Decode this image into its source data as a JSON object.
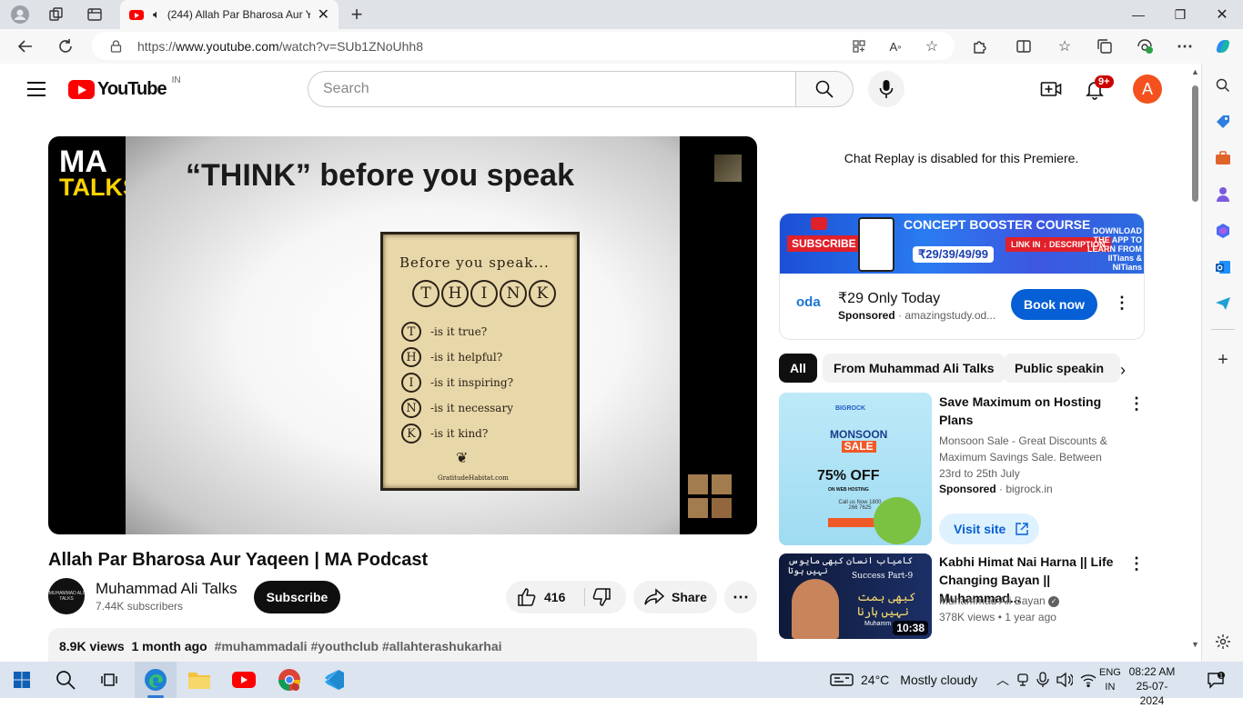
{
  "browser": {
    "tab_title": "(244) Allah Par Bharosa Aur Yaqe",
    "url_prefix": "https://",
    "url_domain": "www.youtube.com",
    "url_path": "/watch?v=SUb1ZNoUhh8"
  },
  "youtube": {
    "logo_text": "YouTube",
    "country_code": "IN",
    "search_placeholder": "Search",
    "notif_badge": "9+",
    "avatar_letter": "A"
  },
  "video": {
    "slide_heading": "“THINK” before you speak",
    "logo_line1": "MA",
    "logo_line2": "TALKS",
    "paper_title": "Before you speak...",
    "think_letters": [
      "T",
      "H",
      "I",
      "N",
      "K"
    ],
    "think_rows": [
      {
        "letter": "T",
        "text": "-is it true?"
      },
      {
        "letter": "H",
        "text": "-is it helpful?"
      },
      {
        "letter": "I",
        "text": "-is it inspiring?"
      },
      {
        "letter": "N",
        "text": "-is it necessary"
      },
      {
        "letter": "K",
        "text": "-is it kind?"
      }
    ],
    "paper_footer": "GratitudeHabitat.com",
    "title": "Allah Par Bharosa Aur Yaqeen | MA Podcast",
    "channel_name": "Muhammad Ali Talks",
    "channel_avatar_text": "MUHAMMAD ALI TALKS",
    "subscribers": "7.44K subscribers",
    "subscribe_label": "Subscribe",
    "likes": "416",
    "share_label": "Share",
    "views": "8.9K views",
    "age": "1 month ago",
    "hashtags": "#muhammadali #youthclub #allahterashukarhai"
  },
  "sidebar": {
    "chat_message": "Chat Replay is disabled for this Premiere.",
    "ad": {
      "banner_subscribe": "SUBSCRIBE",
      "banner_title": "CONCEPT BOOSTER COURSE",
      "banner_price": "₹29/39/49/99",
      "banner_link": "LINK IN ↓ DESCRIPTION",
      "banner_download": "DOWNLOAD THE APP TO LEARN FROM IITians & NITians",
      "brand": "oda",
      "headline": "₹29 Only Today",
      "sponsored": "Sponsored",
      "domain": "amazingstudy.od...",
      "cta": "Book now"
    },
    "chips": [
      "All",
      "From Muhammad Ali Talks",
      "Public speakin"
    ],
    "items": [
      {
        "title": "Save Maximum on Hosting Plans",
        "description": "Monsoon Sale - Great Discounts & Maximum Savings Sale. Between 23rd to 25th July",
        "sponsored": "Sponsored",
        "domain": "bigrock.in",
        "cta": "Visit site",
        "thumb_brand": "BIGROCK",
        "thumb_sale": "MONSOON",
        "thumb_sale2": "SALE",
        "thumb_off": "75% OFF",
        "thumb_web": "ON WEB HOSTING",
        "thumb_call": "Call us Now 1800 266 7625"
      },
      {
        "title": "Kabhi Himat Nai Harna || Life Changing Bayan || Muhammad...",
        "channel": "Muhammad Ali Bayan",
        "views": "378K views",
        "age": "1 year ago",
        "duration": "10:38",
        "thumb_urdu1": "کامیاب انسان کبھی مایوس نہیں ہوتا",
        "thumb_part": "Success Part-9",
        "thumb_urdu2": "کبھی ہمت نہیں ہارنا",
        "thumb_name": "Muhamm"
      }
    ]
  },
  "taskbar": {
    "temperature": "24°C",
    "weather": "Mostly cloudy",
    "lang1": "ENG",
    "lang2": "IN",
    "time": "08:22 AM",
    "date": "25-07-2024"
  }
}
